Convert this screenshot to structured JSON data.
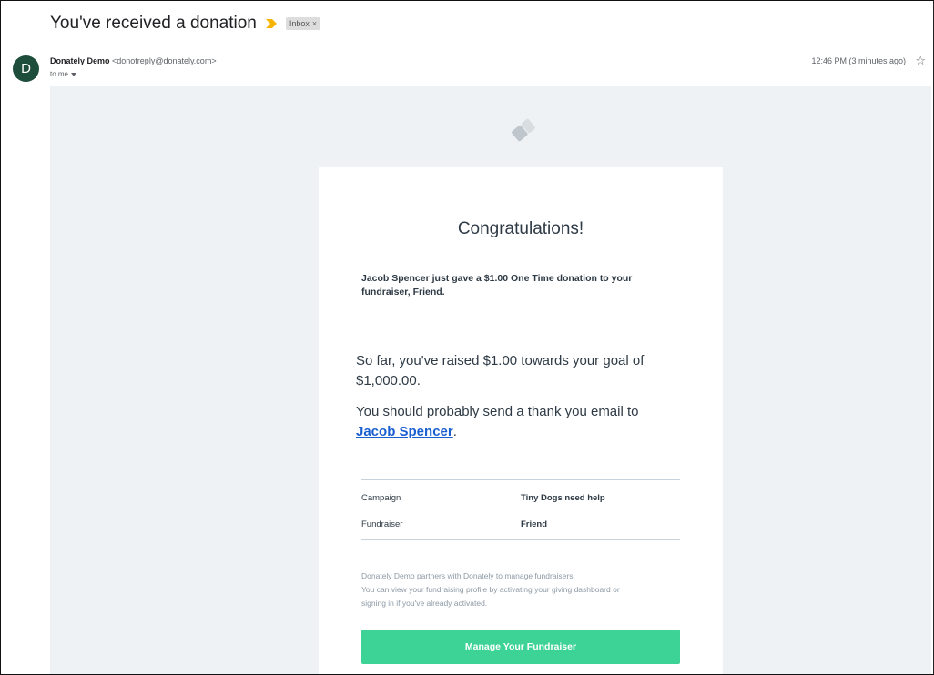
{
  "email": {
    "subject": "You've received a donation",
    "label": "Inbox",
    "label_close": "×",
    "avatar_letter": "D",
    "sender_name": "Donately Demo",
    "sender_address": "<donotreply@donately.com>",
    "recipient": "to me",
    "time": "12:46 PM (3 minutes ago)",
    "star": "☆"
  },
  "body": {
    "heading": "Congratulations!",
    "intro": "Jacob Spencer just gave a $1.00 One Time donation to your fundraiser, Friend.",
    "raised": "So far, you've raised $1.00 towards your goal of $1,000.00.",
    "thanks_prefix": "You should probably send a thank you email to ",
    "donor_link": "Jacob Spencer",
    "thanks_suffix": ".",
    "details": [
      {
        "key": "Campaign",
        "value": "Tiny Dogs need help"
      },
      {
        "key": "Fundraiser",
        "value": "Friend"
      }
    ],
    "footer_lines": [
      "Donately Demo partners with Donately to manage fundraisers.",
      "You can view your fundraising profile by activating your giving dashboard or",
      "signing in if you've already activated."
    ],
    "cta_label": "Manage Your Fundraiser"
  },
  "colors": {
    "avatar": "#1e4d3c",
    "importance": "#f4b400",
    "cta": "#3ed396",
    "link": "#1a5fd0",
    "email_background": "#eef2f5"
  }
}
